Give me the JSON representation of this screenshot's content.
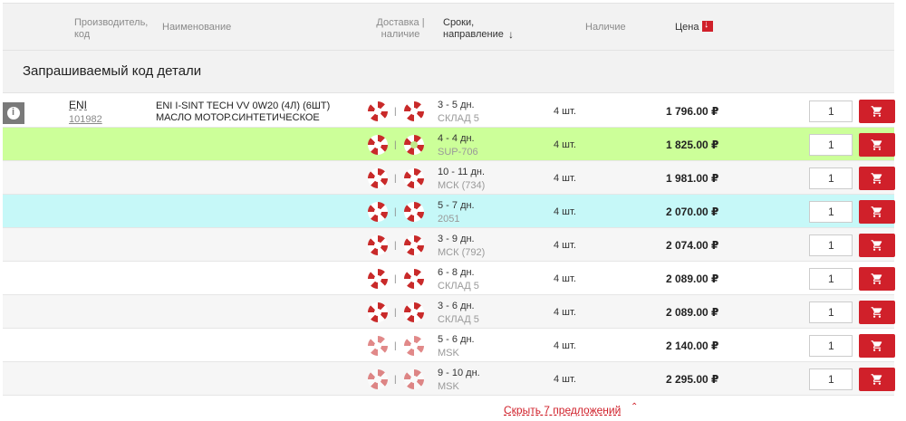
{
  "header": {
    "maker_code": "Производитель,\nкод",
    "name": "Наименование",
    "delivery": "Доставка |\nналичие",
    "terms": "Сроки,\nнаправление",
    "availability": "Наличие",
    "price": "Цена"
  },
  "section_title": "Запрашиваемый код детали",
  "part": {
    "maker": "ENI",
    "code": "101982",
    "name": "ENI I-SINT TECH VV 0W20 (4Л) (6ШТ) МАСЛО МОТОР.СИНТЕТИЧЕСКОЕ"
  },
  "rows": [
    {
      "days": "3 - 5 дн.",
      "warehouse": "СКЛАД 5",
      "qty": "4 шт.",
      "price": "1 796.00 ₽",
      "amount": "1",
      "bg": "white"
    },
    {
      "days": "4 - 4 дн.",
      "warehouse": "SUP-706",
      "qty": "4 шт.",
      "price": "1 825.00 ₽",
      "amount": "1",
      "bg": "green"
    },
    {
      "days": "10 - 11 дн.",
      "warehouse": "МСК (734)",
      "qty": "4 шт.",
      "price": "1 981.00 ₽",
      "amount": "1",
      "bg": "alt"
    },
    {
      "days": "5 - 7 дн.",
      "warehouse": "2051",
      "qty": "4 шт.",
      "price": "2 070.00 ₽",
      "amount": "1",
      "bg": "cyan"
    },
    {
      "days": "3 - 9 дн.",
      "warehouse": "МСК (792)",
      "qty": "4 шт.",
      "price": "2 074.00 ₽",
      "amount": "1",
      "bg": "alt"
    },
    {
      "days": "6 - 8 дн.",
      "warehouse": "СКЛАД 5",
      "qty": "4 шт.",
      "price": "2 089.00 ₽",
      "amount": "1",
      "bg": "white"
    },
    {
      "days": "3 - 6 дн.",
      "warehouse": "СКЛАД 5",
      "qty": "4 шт.",
      "price": "2 089.00 ₽",
      "amount": "1",
      "bg": "alt"
    },
    {
      "days": "5 - 6 дн.",
      "warehouse": "MSK",
      "qty": "4 шт.",
      "price": "2 140.00 ₽",
      "amount": "1",
      "bg": "white"
    },
    {
      "days": "9 - 10 дн.",
      "warehouse": "MSK",
      "qty": "4 шт.",
      "price": "2 295.00 ₽",
      "amount": "1",
      "bg": "alt"
    }
  ],
  "toggle_label": "Скрыть 7 предложений",
  "colors": {
    "accent": "#d0202a",
    "green_row": "#ccff99",
    "cyan_row": "#c6f8f8"
  }
}
